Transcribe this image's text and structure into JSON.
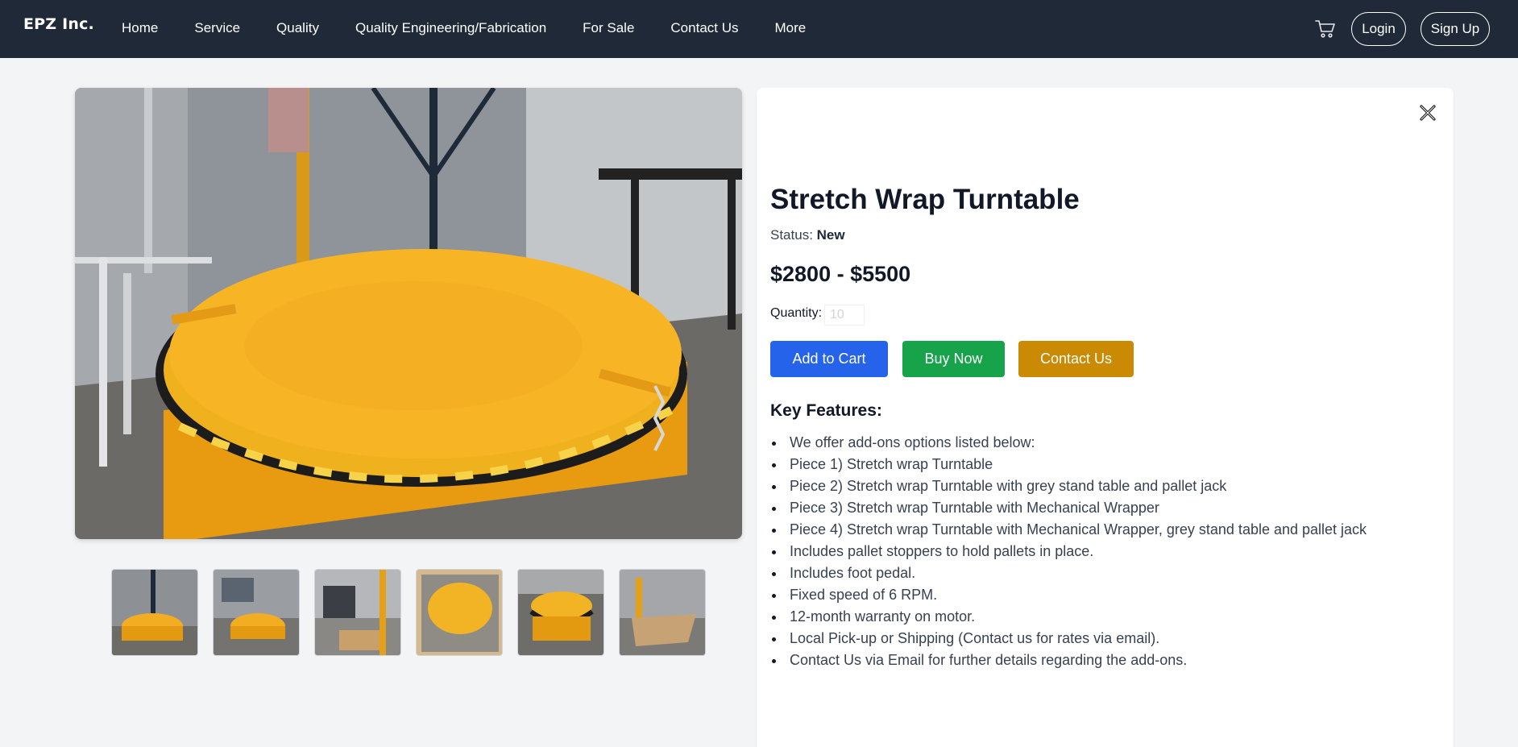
{
  "navbar": {
    "brand": "EPZ Inc.",
    "links": [
      "Home",
      "Service",
      "Quality",
      "Quality Engineering/Fabrication",
      "For Sale",
      "Contact Us",
      "More"
    ],
    "cart_icon": "shopping-cart-icon",
    "login_label": "Login",
    "signup_label": "Sign Up"
  },
  "gallery": {
    "main_image_subject": "yellow-stretch-wrap-turntable-photo",
    "thumbnail_count": 6
  },
  "product": {
    "close_icon": "close-x-icon",
    "title": "Stretch Wrap Turntable",
    "status_label": "Status:",
    "status_value": "New",
    "price": "$2800 - $5500",
    "quantity_label": "Quantity:",
    "quantity_placeholder": "10",
    "add_to_cart_label": "Add to Cart",
    "buy_now_label": "Buy Now",
    "contact_label": "Contact Us",
    "features_title": "Key Features:",
    "features": [
      "We offer add-ons options listed below:",
      "Piece 1) Stretch wrap Turntable",
      "Piece 2) Stretch wrap Turntable with grey stand table and pallet jack",
      "Piece 3) Stretch wrap Turntable with Mechanical Wrapper",
      "Piece 4) Stretch wrap Turntable with Mechanical Wrapper, grey stand table and pallet jack",
      "Includes pallet stoppers to hold pallets in place.",
      "Includes foot pedal.",
      "Fixed speed of 6 RPM.",
      "12-month warranty on motor.",
      "Local Pick-up or Shipping (Contact us for rates via email).",
      "Contact Us via Email for further details regarding the add-ons."
    ]
  },
  "colors": {
    "navbar_bg": "#1f2937",
    "page_bg": "#f3f4f6",
    "add_to_cart": "#2563eb",
    "buy_now": "#16a34a",
    "contact": "#ca8a04",
    "turntable_yellow": "#f5a81c"
  }
}
